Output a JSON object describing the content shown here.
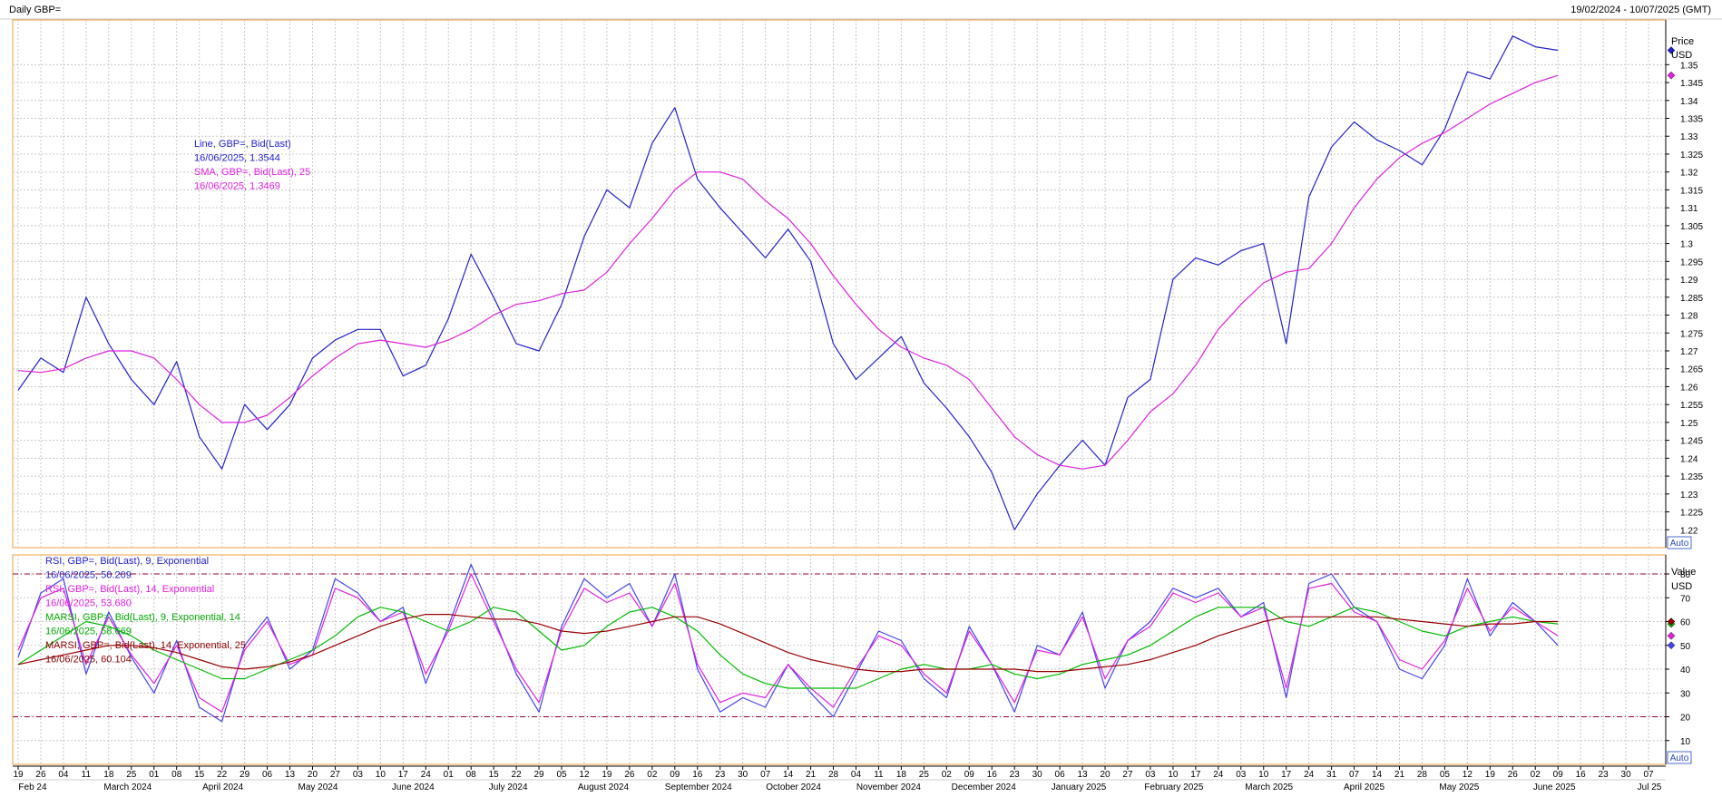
{
  "header": {
    "title": "Daily GBP=",
    "date_range": "19/02/2024 - 10/07/2025 (GMT)"
  },
  "price_panel": {
    "axis_title": "Price",
    "axis_unit": "USD",
    "auto_label": "Auto",
    "legend": [
      {
        "text": "Line, GBP=, Bid(Last)",
        "color": "#2222cc"
      },
      {
        "text": "16/06/2025, 1.3544",
        "color": "#2222cc"
      },
      {
        "text": "SMA, GBP=, Bid(Last),  25",
        "color": "#e020e0"
      },
      {
        "text": "16/06/2025, 1.3469",
        "color": "#e020e0"
      }
    ]
  },
  "rsi_panel": {
    "axis_title": "Value",
    "axis_unit": "USD",
    "auto_label": "Auto",
    "legend": [
      {
        "text": "RSI, GBP=, Bid(Last),  9, Exponential",
        "color": "#2222cc"
      },
      {
        "text": "16/06/2025, 50.209",
        "color": "#2222cc"
      },
      {
        "text": "RSI, GBP=, Bid(Last),  14, Exponential",
        "color": "#e020e0"
      },
      {
        "text": "16/06/2025, 53.680",
        "color": "#e020e0"
      },
      {
        "text": "MARSI, GBP=, Bid(Last),  9, Exponential, 14",
        "color": "#00aa00"
      },
      {
        "text": "16/06/2025, 58.669",
        "color": "#00aa00"
      },
      {
        "text": "MARSI, GBP=, Bid(Last),  14, Exponential, 25",
        "color": "#8b0000"
      },
      {
        "text": "16/06/2025, 60.104",
        "color": "#8b0000"
      }
    ]
  },
  "colors": {
    "price": "#2222cc",
    "sma": "#e020e0",
    "rsi9": "#4444ee",
    "rsi14": "#e020e0",
    "marsi9": "#00bb00",
    "marsi14": "#990000",
    "grid": "#c8c8c8",
    "panel_border": "#f0a040",
    "ref_lines": "#990033"
  },
  "chart_data": [
    {
      "type": "line",
      "panel": "price",
      "ylim": [
        1.215,
        1.3625
      ],
      "yticks": [
        1.22,
        1.225,
        1.23,
        1.235,
        1.24,
        1.245,
        1.25,
        1.255,
        1.26,
        1.265,
        1.27,
        1.275,
        1.28,
        1.285,
        1.29,
        1.295,
        1.3,
        1.305,
        1.31,
        1.315,
        1.32,
        1.325,
        1.33,
        1.335,
        1.34,
        1.345,
        1.35
      ],
      "ytick_labels": [
        "1.22",
        "1.225",
        "1.23",
        "1.235",
        "1.24",
        "1.245",
        "1.25",
        "1.255",
        "1.26",
        "1.265",
        "1.27",
        "1.275",
        "1.28",
        "1.285",
        "1.29",
        "1.295",
        "1.3",
        "1.305",
        "1.31",
        "1.315",
        "1.32",
        "1.325",
        "1.33",
        "1.335",
        "1.34",
        "1.345",
        "1.35"
      ],
      "grid": true,
      "x_week_index": [
        0,
        1,
        2,
        3,
        4,
        5,
        6,
        7,
        8,
        9,
        10,
        11,
        12,
        13,
        14,
        15,
        16,
        17,
        18,
        19,
        20,
        21,
        22,
        23,
        24,
        25,
        26,
        27,
        28,
        29,
        30,
        31,
        32,
        33,
        34,
        35,
        36,
        37,
        38,
        39,
        40,
        41,
        42,
        43,
        44,
        45,
        46,
        47,
        48,
        49,
        50,
        51,
        52,
        53,
        54,
        55,
        56,
        57,
        58,
        59,
        60,
        61,
        62,
        63,
        64,
        65,
        66,
        67,
        68,
        69,
        70,
        71,
        72,
        73
      ],
      "series": [
        {
          "name": "Line, GBP=, Bid(Last)",
          "values": [
            1.259,
            1.268,
            1.264,
            1.285,
            1.272,
            1.262,
            1.255,
            1.267,
            1.246,
            1.237,
            1.255,
            1.248,
            1.255,
            1.268,
            1.273,
            1.276,
            1.276,
            1.263,
            1.266,
            1.279,
            1.297,
            1.285,
            1.272,
            1.27,
            1.283,
            1.302,
            1.315,
            1.31,
            1.328,
            1.338,
            1.318,
            1.31,
            1.303,
            1.296,
            1.304,
            1.295,
            1.272,
            1.262,
            1.268,
            1.274,
            1.261,
            1.254,
            1.246,
            1.236,
            1.22,
            1.23,
            1.238,
            1.245,
            1.238,
            1.257,
            1.262,
            1.29,
            1.296,
            1.294,
            1.298,
            1.3,
            1.272,
            1.313,
            1.327,
            1.334,
            1.329,
            1.326,
            1.322,
            1.332,
            1.348,
            1.346,
            1.358,
            1.355,
            1.354
          ]
        },
        {
          "name": "SMA, GBP=, Bid(Last),  25",
          "values": [
            1.2645,
            1.264,
            1.265,
            1.268,
            1.27,
            1.27,
            1.268,
            1.262,
            1.255,
            1.25,
            1.25,
            1.252,
            1.257,
            1.263,
            1.268,
            1.272,
            1.273,
            1.272,
            1.271,
            1.273,
            1.276,
            1.28,
            1.283,
            1.284,
            1.286,
            1.287,
            1.292,
            1.3,
            1.307,
            1.315,
            1.32,
            1.32,
            1.318,
            1.312,
            1.307,
            1.3,
            1.291,
            1.283,
            1.276,
            1.271,
            1.268,
            1.266,
            1.262,
            1.254,
            1.246,
            1.241,
            1.238,
            1.237,
            1.238,
            1.245,
            1.253,
            1.258,
            1.266,
            1.276,
            1.283,
            1.289,
            1.292,
            1.293,
            1.3,
            1.31,
            1.318,
            1.324,
            1.328,
            1.331,
            1.335,
            1.339,
            1.342,
            1.345,
            1.347
          ]
        }
      ]
    },
    {
      "type": "line",
      "panel": "rsi",
      "ylim": [
        0,
        88
      ],
      "yticks": [
        10,
        20,
        30,
        40,
        50,
        60,
        70,
        80
      ],
      "ytick_labels": [
        "10",
        "20",
        "30",
        "40",
        "50",
        "60",
        "70",
        "80"
      ],
      "reference_lines": [
        20,
        80
      ],
      "grid": true,
      "x_week_index": [
        0,
        1,
        2,
        3,
        4,
        5,
        6,
        7,
        8,
        9,
        10,
        11,
        12,
        13,
        14,
        15,
        16,
        17,
        18,
        19,
        20,
        21,
        22,
        23,
        24,
        25,
        26,
        27,
        28,
        29,
        30,
        31,
        32,
        33,
        34,
        35,
        36,
        37,
        38,
        39,
        40,
        41,
        42,
        43,
        44,
        45,
        46,
        47,
        48,
        49,
        50,
        51,
        52,
        53,
        54,
        55,
        56,
        57,
        58,
        59,
        60,
        61,
        62,
        63,
        64,
        65,
        66,
        67,
        68,
        69,
        70,
        71,
        72,
        73
      ],
      "series": [
        {
          "name": "RSI, GBP=, Bid(Last),  9, Exponential",
          "values": [
            45,
            72,
            78,
            38,
            64,
            45,
            30,
            52,
            24,
            18,
            50,
            62,
            40,
            48,
            78,
            72,
            60,
            66,
            34,
            58,
            84,
            62,
            38,
            22,
            58,
            78,
            70,
            76,
            58,
            80,
            40,
            22,
            28,
            24,
            42,
            30,
            20,
            38,
            56,
            52,
            36,
            28,
            58,
            42,
            22,
            50,
            46,
            64,
            32,
            52,
            60,
            74,
            70,
            74,
            62,
            68,
            28,
            76,
            80,
            66,
            60,
            40,
            36,
            50,
            78,
            54,
            68,
            60,
            50
          ]
        },
        {
          "name": "RSI, GBP=, Bid(Last),  14, Exponential",
          "values": [
            48,
            70,
            74,
            42,
            62,
            46,
            34,
            50,
            28,
            22,
            48,
            60,
            42,
            46,
            74,
            70,
            60,
            64,
            38,
            56,
            80,
            60,
            40,
            26,
            56,
            74,
            68,
            72,
            58,
            76,
            42,
            26,
            30,
            28,
            42,
            32,
            24,
            40,
            54,
            50,
            38,
            30,
            56,
            42,
            26,
            48,
            46,
            62,
            36,
            52,
            58,
            72,
            68,
            72,
            62,
            66,
            32,
            74,
            76,
            64,
            60,
            44,
            40,
            52,
            74,
            56,
            66,
            60,
            54
          ]
        },
        {
          "name": "MARSI, GBP=, Bid(Last),  9, Exponential, 14",
          "values": [
            42,
            48,
            54,
            60,
            58,
            54,
            48,
            44,
            40,
            36,
            36,
            40,
            44,
            48,
            54,
            62,
            66,
            64,
            60,
            56,
            60,
            66,
            64,
            56,
            48,
            50,
            58,
            64,
            66,
            62,
            56,
            46,
            38,
            34,
            32,
            32,
            32,
            32,
            36,
            40,
            42,
            40,
            40,
            42,
            38,
            36,
            38,
            42,
            44,
            46,
            50,
            56,
            62,
            66,
            66,
            66,
            60,
            58,
            62,
            66,
            64,
            60,
            56,
            54,
            58,
            60,
            62,
            60,
            59
          ]
        },
        {
          "name": "MARSI, GBP=, Bid(Last),  14, Exponential, 25",
          "values": [
            42,
            44,
            46,
            48,
            50,
            50,
            49,
            47,
            44,
            41,
            40,
            41,
            43,
            46,
            50,
            54,
            58,
            61,
            63,
            63,
            62,
            61,
            61,
            59,
            56,
            55,
            56,
            58,
            60,
            62,
            62,
            59,
            55,
            51,
            47,
            44,
            42,
            40,
            39,
            39,
            40,
            40,
            40,
            40,
            40,
            39,
            39,
            40,
            41,
            42,
            44,
            47,
            50,
            54,
            57,
            60,
            62,
            62,
            62,
            62,
            62,
            61,
            60,
            59,
            58,
            59,
            59,
            60,
            60
          ]
        }
      ]
    }
  ],
  "x_axis": {
    "day_labels": [
      "19",
      "26",
      "04",
      "11",
      "18",
      "25",
      "01",
      "08",
      "15",
      "22",
      "29",
      "06",
      "13",
      "20",
      "27",
      "03",
      "10",
      "17",
      "24",
      "01",
      "08",
      "15",
      "22",
      "29",
      "05",
      "12",
      "19",
      "26",
      "02",
      "09",
      "16",
      "23",
      "30",
      "07",
      "14",
      "21",
      "28",
      "04",
      "11",
      "18",
      "25",
      "02",
      "09",
      "16",
      "23",
      "30",
      "06",
      "13",
      "20",
      "27",
      "03",
      "10",
      "17",
      "24",
      "03",
      "10",
      "17",
      "24",
      "31",
      "07",
      "14",
      "21",
      "28",
      "05",
      "12",
      "19",
      "26",
      "02",
      "09",
      "16",
      "23",
      "30",
      "07"
    ],
    "month_labels": [
      "Feb 24",
      "March 2024",
      "April 2024",
      "May 2024",
      "June 2024",
      "July 2024",
      "August 2024",
      "September 2024",
      "October 2024",
      "November 2024",
      "December 2024",
      "January 2025",
      "February 2025",
      "March 2025",
      "April 2025",
      "May 2025",
      "June 2025",
      "Jul 25"
    ]
  }
}
